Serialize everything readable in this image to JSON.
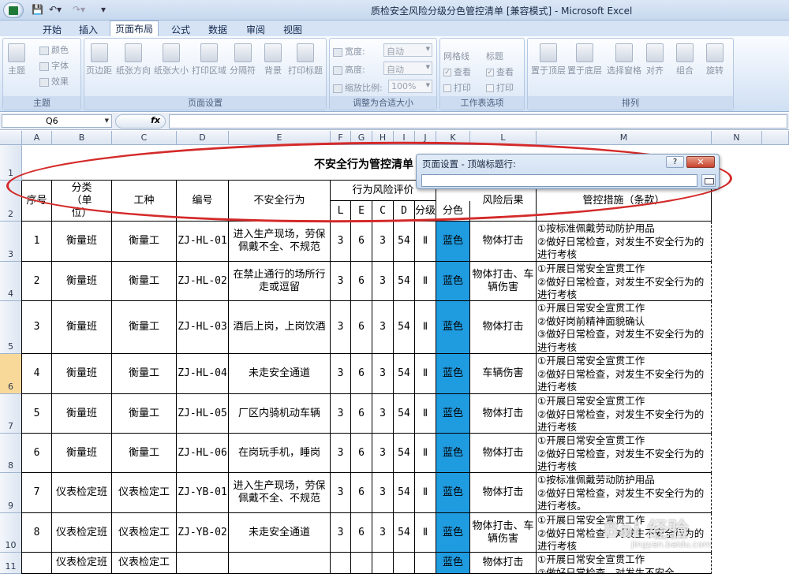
{
  "window": {
    "title": "质检安全风险分级分色管控清单  [兼容模式] - Microsoft Excel",
    "minimize_icon": "minimize-icon",
    "maximize_icon": "maximize-icon",
    "close_icon": "close-icon"
  },
  "ribbon_tabs": [
    "开始",
    "插入",
    "页面布局",
    "公式",
    "数据",
    "审阅",
    "视图"
  ],
  "active_tab": "页面布局",
  "ribbon": {
    "theme_group": {
      "title": "主题",
      "big": "主题",
      "items": [
        "颜色",
        "字体",
        "效果"
      ]
    },
    "page_setup_group": {
      "title": "页面设置",
      "buttons": [
        "页边距",
        "纸张方向",
        "纸张大小",
        "打印区域",
        "分隔符",
        "背景",
        "打印标题"
      ]
    },
    "scale_group": {
      "title": "调整为合适大小",
      "width_label": "宽度:",
      "width_value": "自动",
      "height_label": "高度:",
      "height_value": "自动",
      "scale_label": "缩放比例:",
      "scale_value": "100%"
    },
    "sheet_options_group": {
      "title": "工作表选项",
      "gridlines": "网格线",
      "headings": "标题",
      "view": "查看",
      "print": "打印"
    },
    "arrange_group": {
      "title": "排列",
      "buttons": [
        "置于顶层",
        "置于底层",
        "选择窗格",
        "对齐",
        "组合",
        "旋转"
      ]
    }
  },
  "formula_bar": {
    "name_box": "Q6",
    "fx": "fx",
    "formula": ""
  },
  "columns": [
    "A",
    "B",
    "C",
    "D",
    "E",
    "F",
    "G",
    "H",
    "I",
    "J",
    "K",
    "L",
    "M",
    "N"
  ],
  "rows": [
    "1",
    "2",
    "3",
    "4",
    "5",
    "6",
    "7",
    "8",
    "9",
    "10",
    "11"
  ],
  "selected_row": "6",
  "sheet": {
    "title": "不安全行为管控清单",
    "headers": {
      "seq": "序号",
      "category": "分类（单位）",
      "job": "工种",
      "code": "编号",
      "behavior": "不安全行为",
      "risk_eval": "行为风险评价",
      "L": "L",
      "E": "E",
      "C": "C",
      "D": "D",
      "level": "分级",
      "color": "分色",
      "consequence": "风险后果",
      "measures": "管控措施（条款）"
    },
    "records": [
      {
        "seq": "1",
        "category": "衡量班",
        "job": "衡量工",
        "code": "ZJ-HL-01",
        "behavior": "进入生产现场，劳保佩戴不全、不规范",
        "L": "3",
        "E": "6",
        "C": "3",
        "D": "54",
        "level": "Ⅱ",
        "color": "蓝色",
        "consequence": "物体打击",
        "measures": "①按标准佩戴劳动防护用品\n②做好日常检查，对发生不安全行为的进行考核"
      },
      {
        "seq": "2",
        "category": "衡量班",
        "job": "衡量工",
        "code": "ZJ-HL-02",
        "behavior": "在禁止通行的场所行走或逗留",
        "L": "3",
        "E": "6",
        "C": "3",
        "D": "54",
        "level": "Ⅱ",
        "color": "蓝色",
        "consequence": "物体打击、车辆伤害",
        "measures": "①开展日常安全宣贯工作\n②做好日常检查，对发生不安全行为的进行考核"
      },
      {
        "seq": "3",
        "category": "衡量班",
        "job": "衡量工",
        "code": "ZJ-HL-03",
        "behavior": "酒后上岗，上岗饮酒",
        "L": "3",
        "E": "6",
        "C": "3",
        "D": "54",
        "level": "Ⅱ",
        "color": "蓝色",
        "consequence": "物体打击",
        "measures": "①开展日常安全宣贯工作\n②做好岗前精神面貌确认\n③做好日常检查，对发生不安全行为的进行考核"
      },
      {
        "seq": "4",
        "category": "衡量班",
        "job": "衡量工",
        "code": "ZJ-HL-04",
        "behavior": "未走安全通道",
        "L": "3",
        "E": "6",
        "C": "3",
        "D": "54",
        "level": "Ⅱ",
        "color": "蓝色",
        "consequence": "车辆伤害",
        "measures": "①开展日常安全宣贯工作\n②做好日常检查，对发生不安全行为的进行考核"
      },
      {
        "seq": "5",
        "category": "衡量班",
        "job": "衡量工",
        "code": "ZJ-HL-05",
        "behavior": "厂区内骑机动车辆",
        "L": "3",
        "E": "6",
        "C": "3",
        "D": "54",
        "level": "Ⅱ",
        "color": "蓝色",
        "consequence": "物体打击",
        "measures": "①开展日常安全宣贯工作\n②做好日常检查，对发生不安全行为的进行考核"
      },
      {
        "seq": "6",
        "category": "衡量班",
        "job": "衡量工",
        "code": "ZJ-HL-06",
        "behavior": "在岗玩手机，睡岗",
        "L": "3",
        "E": "6",
        "C": "3",
        "D": "54",
        "level": "Ⅱ",
        "color": "蓝色",
        "consequence": "物体打击",
        "measures": "①开展日常安全宣贯工作\n②做好日常检查，对发生不安全行为的进行考核"
      },
      {
        "seq": "7",
        "category": "仪表检定班",
        "job": "仪表检定工",
        "code": "ZJ-YB-01",
        "behavior": "进入生产现场，劳保佩戴不全、不规范",
        "L": "3",
        "E": "6",
        "C": "3",
        "D": "54",
        "level": "Ⅱ",
        "color": "蓝色",
        "consequence": "物体打击",
        "measures": "①按标准佩戴劳动防护用品\n②做好日常检查，对发生不安全行为的进行考核。"
      },
      {
        "seq": "8",
        "category": "仪表检定班",
        "job": "仪表检定工",
        "code": "ZJ-YB-02",
        "behavior": "未走安全通道",
        "L": "3",
        "E": "6",
        "C": "3",
        "D": "54",
        "level": "Ⅱ",
        "color": "蓝色",
        "consequence": "物体打击、车辆伤害",
        "measures": "①开展日常安全宣贯工作\n②做好日常检查，对发生不安全行为的进行考核"
      },
      {
        "seq": "",
        "category": "仪表检定班",
        "job": "仪表检定工",
        "code": "",
        "behavior": "",
        "L": "",
        "E": "",
        "C": "",
        "D": "",
        "level": "",
        "color": "蓝色",
        "consequence": "物体打击",
        "measures": "①开展日常安全宣贯工作\n②做好日常检查，对发生不安全"
      }
    ]
  },
  "dialog": {
    "title": "页面设置 - 顶端标题行:",
    "help": "?",
    "close": "✕",
    "value": ""
  },
  "watermark": {
    "text": "Bai 经验",
    "sub": "jingyan.baidu.com"
  },
  "colors": {
    "risk_blue": "#1f9be0",
    "annotation_red": "#d42a2a",
    "selected_row": "#f9d99a"
  }
}
